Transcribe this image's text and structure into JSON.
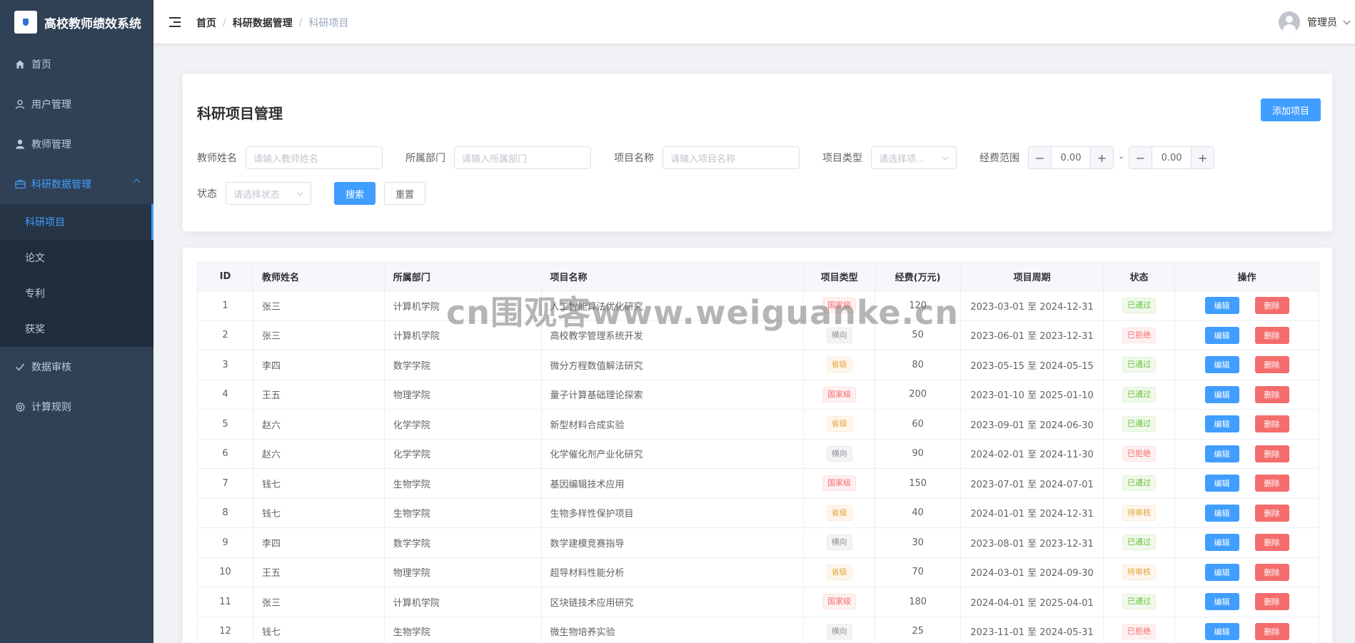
{
  "app": {
    "title": "高校教师绩效系统"
  },
  "sidebar": {
    "items": [
      {
        "label": "首页",
        "icon": "home-icon"
      },
      {
        "label": "用户管理",
        "icon": "user-icon"
      },
      {
        "label": "教师管理",
        "icon": "person-filled-icon"
      },
      {
        "label": "科研数据管理",
        "icon": "briefcase-icon"
      }
    ],
    "sub_items": [
      {
        "label": "科研项目"
      },
      {
        "label": "论文"
      },
      {
        "label": "专利"
      },
      {
        "label": "获奖"
      }
    ],
    "bottom_items": [
      {
        "label": "数据审核",
        "icon": "check-icon"
      },
      {
        "label": "计算规则",
        "icon": "gear-icon"
      }
    ]
  },
  "header": {
    "breadcrumb": [
      "首页",
      "科研数据管理",
      "科研项目"
    ],
    "separator": "/",
    "user_name": "管理员"
  },
  "search": {
    "title": "科研项目管理",
    "add_button": "添加项目",
    "teacher_label": "教师姓名",
    "teacher_placeholder": "请输入教师姓名",
    "dept_label": "所属部门",
    "dept_placeholder": "请输入所属部门",
    "project_label": "项目名称",
    "project_placeholder": "请输入项目名称",
    "type_label": "项目类型",
    "type_placeholder": "请选择项...",
    "fund_label": "经费范围",
    "fund_min": "0.00",
    "fund_max": "0.00",
    "minus": "−",
    "plus": "+",
    "dash": "-",
    "status_label": "状态",
    "status_placeholder": "请选择状态",
    "search_button": "搜索",
    "reset_button": "重置"
  },
  "table": {
    "headers": [
      "ID",
      "教师姓名",
      "所属部门",
      "项目名称",
      "项目类型",
      "经费(万元)",
      "项目周期",
      "状态",
      "操作"
    ],
    "edit_label": "编辑",
    "delete_label": "删除",
    "rows": [
      {
        "id": "1",
        "teacher": "张三",
        "dept": "计算机学院",
        "name": "人工智能算法优化研究",
        "type": "国家级",
        "type_color": "red",
        "fund": "120",
        "period": "2023-03-01 至 2024-12-31",
        "status": "已通过",
        "status_color": "green"
      },
      {
        "id": "2",
        "teacher": "张三",
        "dept": "计算机学院",
        "name": "高校教学管理系统开发",
        "type": "横向",
        "type_color": "gray",
        "fund": "50",
        "period": "2023-06-01 至 2023-12-31",
        "status": "已拒绝",
        "status_color": "red"
      },
      {
        "id": "3",
        "teacher": "李四",
        "dept": "数学学院",
        "name": "微分方程数值解法研究",
        "type": "省级",
        "type_color": "orange",
        "fund": "80",
        "period": "2023-05-15 至 2024-05-15",
        "status": "已通过",
        "status_color": "green"
      },
      {
        "id": "4",
        "teacher": "王五",
        "dept": "物理学院",
        "name": "量子计算基础理论探索",
        "type": "国家级",
        "type_color": "red",
        "fund": "200",
        "period": "2023-01-10 至 2025-01-10",
        "status": "已通过",
        "status_color": "green"
      },
      {
        "id": "5",
        "teacher": "赵六",
        "dept": "化学学院",
        "name": "新型材料合成实验",
        "type": "省级",
        "type_color": "orange",
        "fund": "60",
        "period": "2023-09-01 至 2024-06-30",
        "status": "已通过",
        "status_color": "green"
      },
      {
        "id": "6",
        "teacher": "赵六",
        "dept": "化学学院",
        "name": "化学催化剂产业化研究",
        "type": "横向",
        "type_color": "gray",
        "fund": "90",
        "period": "2024-02-01 至 2024-11-30",
        "status": "已拒绝",
        "status_color": "red"
      },
      {
        "id": "7",
        "teacher": "钱七",
        "dept": "生物学院",
        "name": "基因编辑技术应用",
        "type": "国家级",
        "type_color": "red",
        "fund": "150",
        "period": "2023-07-01 至 2024-07-01",
        "status": "已通过",
        "status_color": "green"
      },
      {
        "id": "8",
        "teacher": "钱七",
        "dept": "生物学院",
        "name": "生物多样性保护项目",
        "type": "省级",
        "type_color": "orange",
        "fund": "40",
        "period": "2024-01-01 至 2024-12-31",
        "status": "待审核",
        "status_color": "orange"
      },
      {
        "id": "9",
        "teacher": "李四",
        "dept": "数学学院",
        "name": "数学建模竞赛指导",
        "type": "横向",
        "type_color": "gray",
        "fund": "30",
        "period": "2023-08-01 至 2023-12-31",
        "status": "已通过",
        "status_color": "green"
      },
      {
        "id": "10",
        "teacher": "王五",
        "dept": "物理学院",
        "name": "超导材料性能分析",
        "type": "省级",
        "type_color": "orange",
        "fund": "70",
        "period": "2024-03-01 至 2024-09-30",
        "status": "待审核",
        "status_color": "orange"
      },
      {
        "id": "11",
        "teacher": "张三",
        "dept": "计算机学院",
        "name": "区块链技术应用研究",
        "type": "国家级",
        "type_color": "red",
        "fund": "180",
        "period": "2024-04-01 至 2025-04-01",
        "status": "已通过",
        "status_color": "green"
      },
      {
        "id": "12",
        "teacher": "钱七",
        "dept": "生物学院",
        "name": "微生物培养实验",
        "type": "横向",
        "type_color": "gray",
        "fund": "25",
        "period": "2023-11-01 至 2024-05-31",
        "status": "已拒绝",
        "status_color": "red"
      }
    ]
  },
  "watermark": {
    "text": "cn围观客www.weiguanke.cn"
  },
  "colors": {
    "sidebar_bg": "#304156",
    "accent": "#409eff",
    "danger": "#f56c6c"
  }
}
